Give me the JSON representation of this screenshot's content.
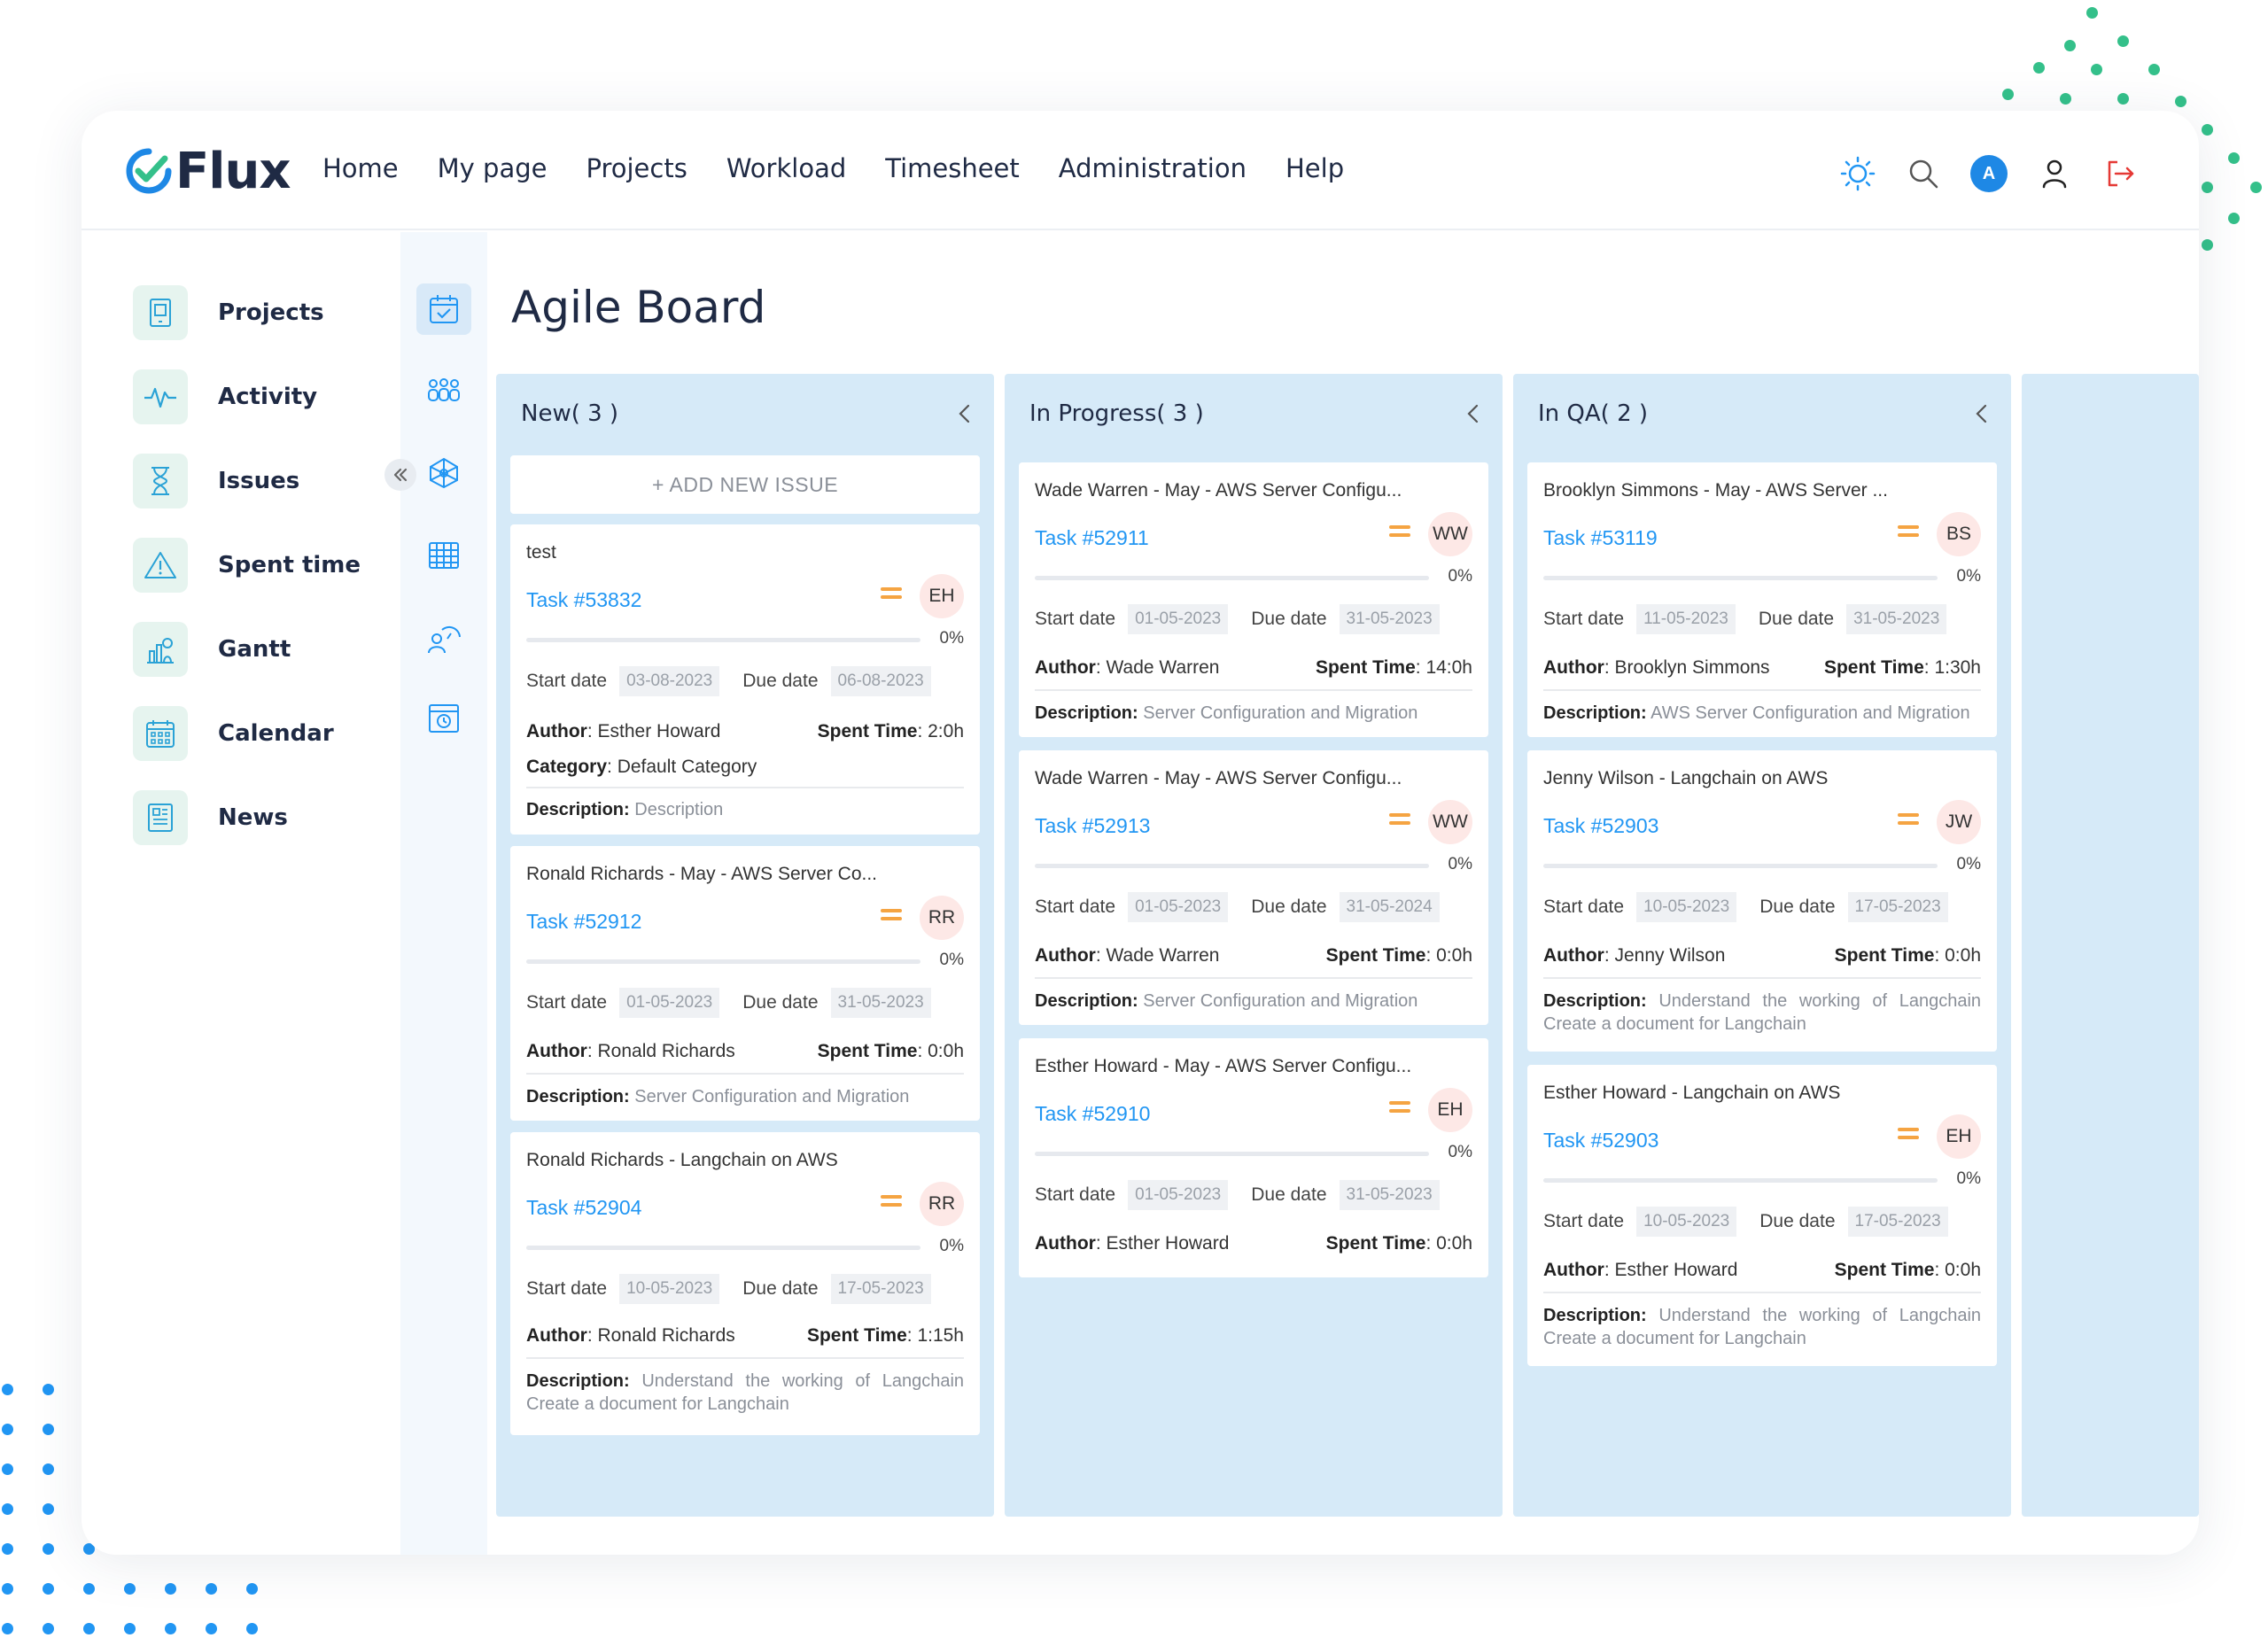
{
  "app": {
    "logo_text": "Flux",
    "nav": [
      "Home",
      "My page",
      "Projects",
      "Workload",
      "Timesheet",
      "Administration",
      "Help"
    ],
    "avatar_initial": "A"
  },
  "sidebar": {
    "items": [
      {
        "label": "Projects",
        "icon": "projects-icon"
      },
      {
        "label": "Activity",
        "icon": "activity-icon"
      },
      {
        "label": "Issues",
        "icon": "hourglass-icon"
      },
      {
        "label": "Spent time",
        "icon": "warning-icon"
      },
      {
        "label": "Gantt",
        "icon": "gantt-icon"
      },
      {
        "label": "Calendar",
        "icon": "calendar-icon"
      },
      {
        "label": "News",
        "icon": "news-icon"
      }
    ]
  },
  "page": {
    "title": "Agile Board"
  },
  "labels": {
    "add_new_issue": "+ ADD NEW ISSUE",
    "start_date": "Start date",
    "due_date": "Due date",
    "author": "Author",
    "spent_time": "Spent Time",
    "description": "Description:",
    "category": "Category"
  },
  "columns": [
    {
      "header": "New( 3 )",
      "cards": [
        {
          "title": "test",
          "task": "Task #53832",
          "initials": "EH",
          "progress": "0%",
          "start": "03-08-2023",
          "due": "06-08-2023",
          "author": "Esther Howard",
          "spent": "2:0h",
          "category": "Default Category",
          "description": "Description"
        },
        {
          "title": "Ronald Richards - May - AWS Server Co...",
          "task": "Task #52912",
          "initials": "RR",
          "progress": "0%",
          "start": "01-05-2023",
          "due": "31-05-2023",
          "author": "Ronald Richards",
          "spent": "0:0h",
          "description": "Server Configuration and Migration"
        },
        {
          "title": "Ronald Richards - Langchain on AWS",
          "task": "Task #52904",
          "initials": "RR",
          "progress": "0%",
          "start": "10-05-2023",
          "due": "17-05-2023",
          "author": "Ronald Richards",
          "spent": "1:15h",
          "description": "Understand the working of Langchain Create a document for Langchain"
        }
      ]
    },
    {
      "header": "In Progress( 3 )",
      "cards": [
        {
          "title": "Wade Warren - May - AWS Server Configu...",
          "task": "Task #52911",
          "initials": "WW",
          "progress": "0%",
          "start": "01-05-2023",
          "due": "31-05-2023",
          "author": "Wade Warren",
          "spent": "14:0h",
          "description": "Server Configuration and Migration"
        },
        {
          "title": "Wade Warren - May - AWS Server Configu...",
          "task": "Task #52913",
          "initials": "WW",
          "progress": "0%",
          "start": "01-05-2023",
          "due": "31-05-2024",
          "author": "Wade Warren",
          "spent": "0:0h",
          "description": "Server Configuration and Migration"
        },
        {
          "title": "Esther Howard - May - AWS Server Configu...",
          "task": "Task #52910",
          "initials": "EH",
          "progress": "0%",
          "start": "01-05-2023",
          "due": "31-05-2023",
          "author": "Esther Howard",
          "spent": "0:0h"
        }
      ]
    },
    {
      "header": "In QA( 2 )",
      "cards": [
        {
          "title": "Brooklyn Simmons - May - AWS Server ...",
          "task": "Task #53119",
          "initials": "BS",
          "progress": "0%",
          "start": "11-05-2023",
          "due": "31-05-2023",
          "author": "Brooklyn Simmons",
          "spent": "1:30h",
          "description": "AWS Server Configuration and Migration"
        },
        {
          "title": "Jenny Wilson - Langchain on AWS",
          "task": "Task #52903",
          "initials": "JW",
          "progress": "0%",
          "start": "10-05-2023",
          "due": "17-05-2023",
          "author": "Jenny Wilson",
          "spent": "0:0h",
          "description": "Understand the working of Langchain Create a document for Langchain"
        },
        {
          "title": "Esther Howard - Langchain on AWS",
          "task": "Task #52903",
          "initials": "EH",
          "progress": "0%",
          "start": "10-05-2023",
          "due": "17-05-2023",
          "author": "Esther Howard",
          "spent": "0:0h",
          "description": "Understand the working of Langchain Create a document for Langchain"
        }
      ]
    }
  ],
  "colors": {
    "accent": "#2196f3",
    "column_bg": "#d6eaf8",
    "priority": "#f5a442",
    "avatar_bg": "#fde8e6",
    "logout": "#e53935",
    "deco_green": "#34c08a"
  }
}
